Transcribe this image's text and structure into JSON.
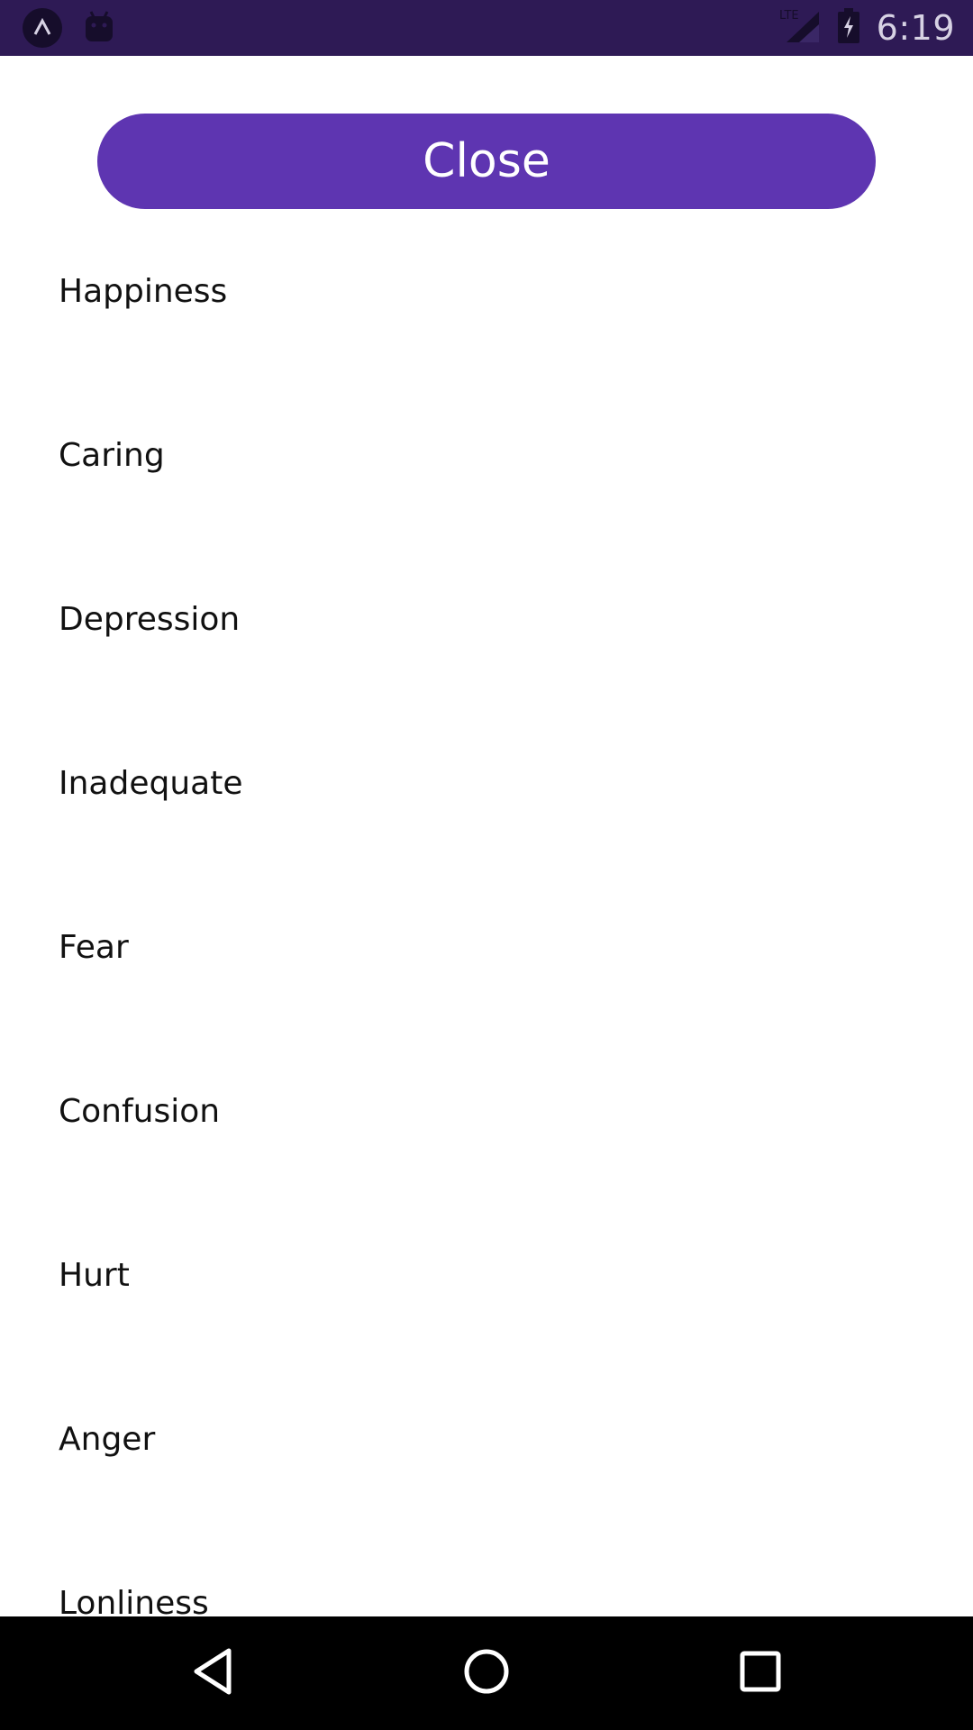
{
  "status_bar": {
    "time": "6:19",
    "network": "LTE",
    "icons": [
      "app-launcher-icon",
      "android-debug-icon",
      "lte-signal-icon",
      "battery-charging-icon"
    ]
  },
  "close_button": {
    "label": "Close"
  },
  "emotions": [
    {
      "label": "Happiness"
    },
    {
      "label": "Caring"
    },
    {
      "label": "Depression"
    },
    {
      "label": "Inadequate"
    },
    {
      "label": "Fear"
    },
    {
      "label": "Confusion"
    },
    {
      "label": "Hurt"
    },
    {
      "label": "Anger"
    },
    {
      "label": "Lonliness"
    }
  ],
  "nav_bar": {
    "icons": [
      "back-icon",
      "home-icon",
      "recents-icon"
    ]
  },
  "colors": {
    "status_bar_bg": "#2e1a55",
    "accent": "#5e35b1",
    "nav_bar_bg": "#000000"
  }
}
